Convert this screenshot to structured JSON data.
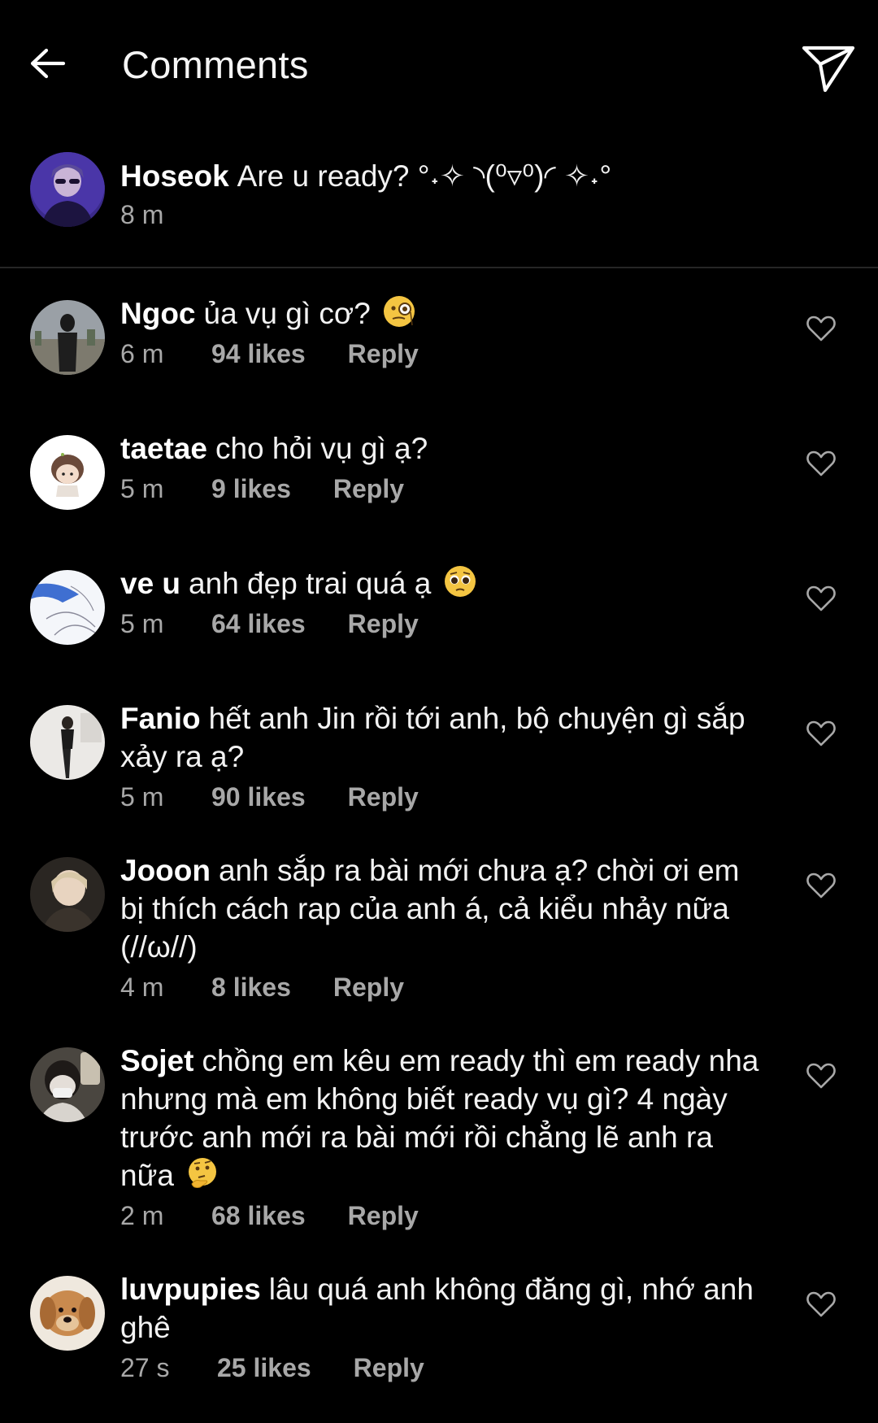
{
  "header": {
    "title": "Comments",
    "back_icon": "arrow-left-icon",
    "share_icon": "paper-plane-icon"
  },
  "caption": {
    "username": "Hoseok",
    "text": "Are u ready? °˖✧ ◝(⁰▿⁰)◜ ✧˖°",
    "time": "8 m"
  },
  "comments": [
    {
      "username": "Ngoc",
      "text": "ủa vụ gì cơ?",
      "emoji": "face-with-monocle",
      "time": "6 m",
      "likes": "94 likes",
      "reply": "Reply"
    },
    {
      "username": "taetae",
      "text": "cho hỏi vụ gì ạ?",
      "emoji": "",
      "time": "5 m",
      "likes": "9 likes",
      "reply": "Reply"
    },
    {
      "username": "ve u",
      "text": "anh đẹp trai quá ạ",
      "emoji": "pleading-face",
      "time": "5 m",
      "likes": "64 likes",
      "reply": "Reply"
    },
    {
      "username": "Fanio",
      "text": "hết anh Jin rồi tới anh, bộ chuyện gì sắp xảy ra ạ?",
      "emoji": "",
      "time": "5 m",
      "likes": "90 likes",
      "reply": "Reply"
    },
    {
      "username": "Jooon",
      "text": "anh sắp ra bài mới chưa ạ? chời ơi em bị thích cách rap của anh á, cả kiểu nhảy nữa (//ω//)",
      "emoji": "",
      "time": "4 m",
      "likes": "8 likes",
      "reply": "Reply"
    },
    {
      "username": "Sojet",
      "text": "chồng em kêu em ready thì em ready nha nhưng mà em không biết ready vụ gì? 4 ngày trước anh mới ra bài mới rồi chẳng lẽ anh ra nữa",
      "emoji": "thinking-face",
      "time": "2 m",
      "likes": "68 likes",
      "reply": "Reply"
    },
    {
      "username": "luvpupies",
      "text": "lâu quá anh không đăng gì, nhớ anh ghê",
      "emoji": "",
      "time": "27 s",
      "likes": "25 likes",
      "reply": "Reply"
    }
  ]
}
